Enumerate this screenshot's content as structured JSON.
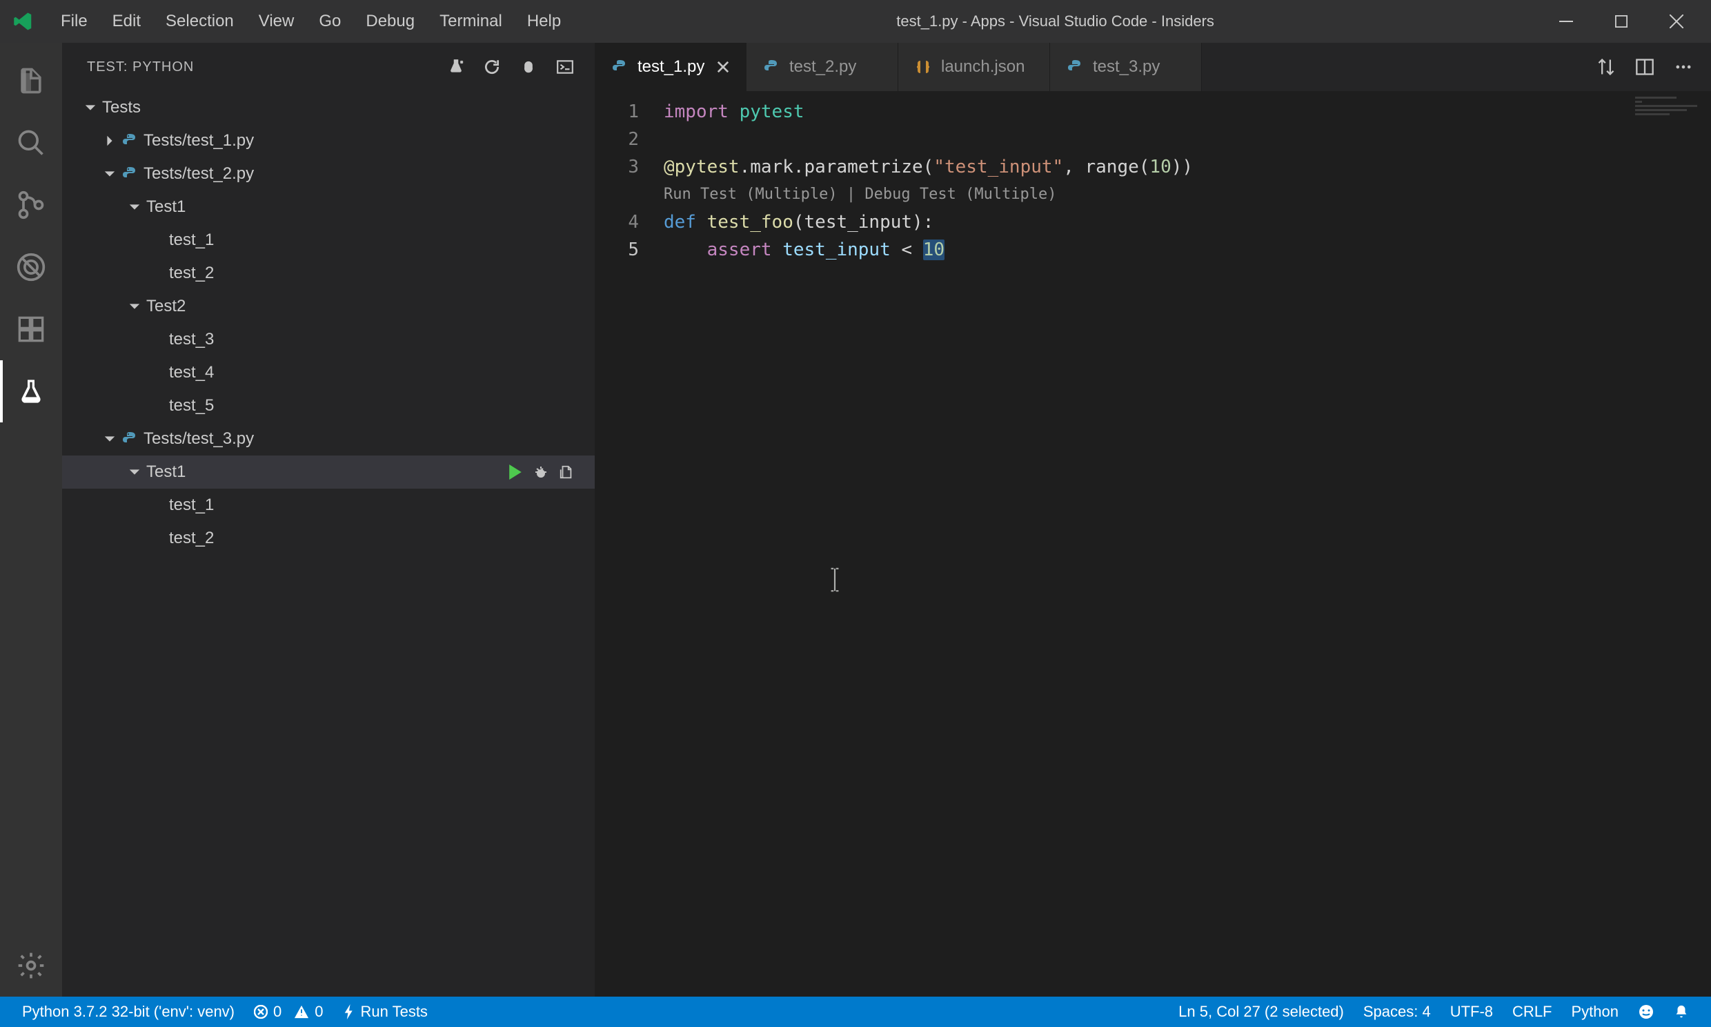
{
  "window": {
    "title": "test_1.py - Apps - Visual Studio Code - Insiders"
  },
  "menu": [
    "File",
    "Edit",
    "Selection",
    "View",
    "Go",
    "Debug",
    "Terminal",
    "Help"
  ],
  "sidebar": {
    "title": "TEST: PYTHON",
    "tree": {
      "root": "Tests",
      "file1": "Tests/test_1.py",
      "file2": "Tests/test_2.py",
      "file2_suite1": "Test1",
      "file2_t1": "test_1",
      "file2_t2": "test_2",
      "file2_suite2": "Test2",
      "file2_t3": "test_3",
      "file2_t4": "test_4",
      "file2_t5": "test_5",
      "file3": "Tests/test_3.py",
      "file3_suite1": "Test1",
      "file3_t1": "test_1",
      "file3_t2": "test_2"
    }
  },
  "tabs": {
    "t1": "test_1.py",
    "t2": "test_2.py",
    "t3": "launch.json",
    "t4": "test_3.py"
  },
  "codelens": "Run Test (Multiple) | Debug Test (Multiple)",
  "code": {
    "l1_kw": "import",
    "l1_mod": " pytest",
    "l3_at": "@pytest",
    "l3_mark": ".mark.parametrize(",
    "l3_str": "\"test_input\"",
    "l3_r": ", range(",
    "l3_n": "10",
    "l3_end": "))",
    "l4_def": "def",
    "l4_fn": " test_foo",
    "l4_p": "(test_input):",
    "l5_indent": "    ",
    "l5_kw": "assert",
    "l5_var": " test_input ",
    "l5_op": "< ",
    "l5_num": "10"
  },
  "status": {
    "python": "Python 3.7.2 32-bit ('env': venv)",
    "errors": "0",
    "warnings": "0",
    "runtests": "Run Tests",
    "cursor": "Ln 5, Col 27 (2 selected)",
    "spaces": "Spaces: 4",
    "encoding": "UTF-8",
    "eol": "CRLF",
    "lang": "Python"
  }
}
